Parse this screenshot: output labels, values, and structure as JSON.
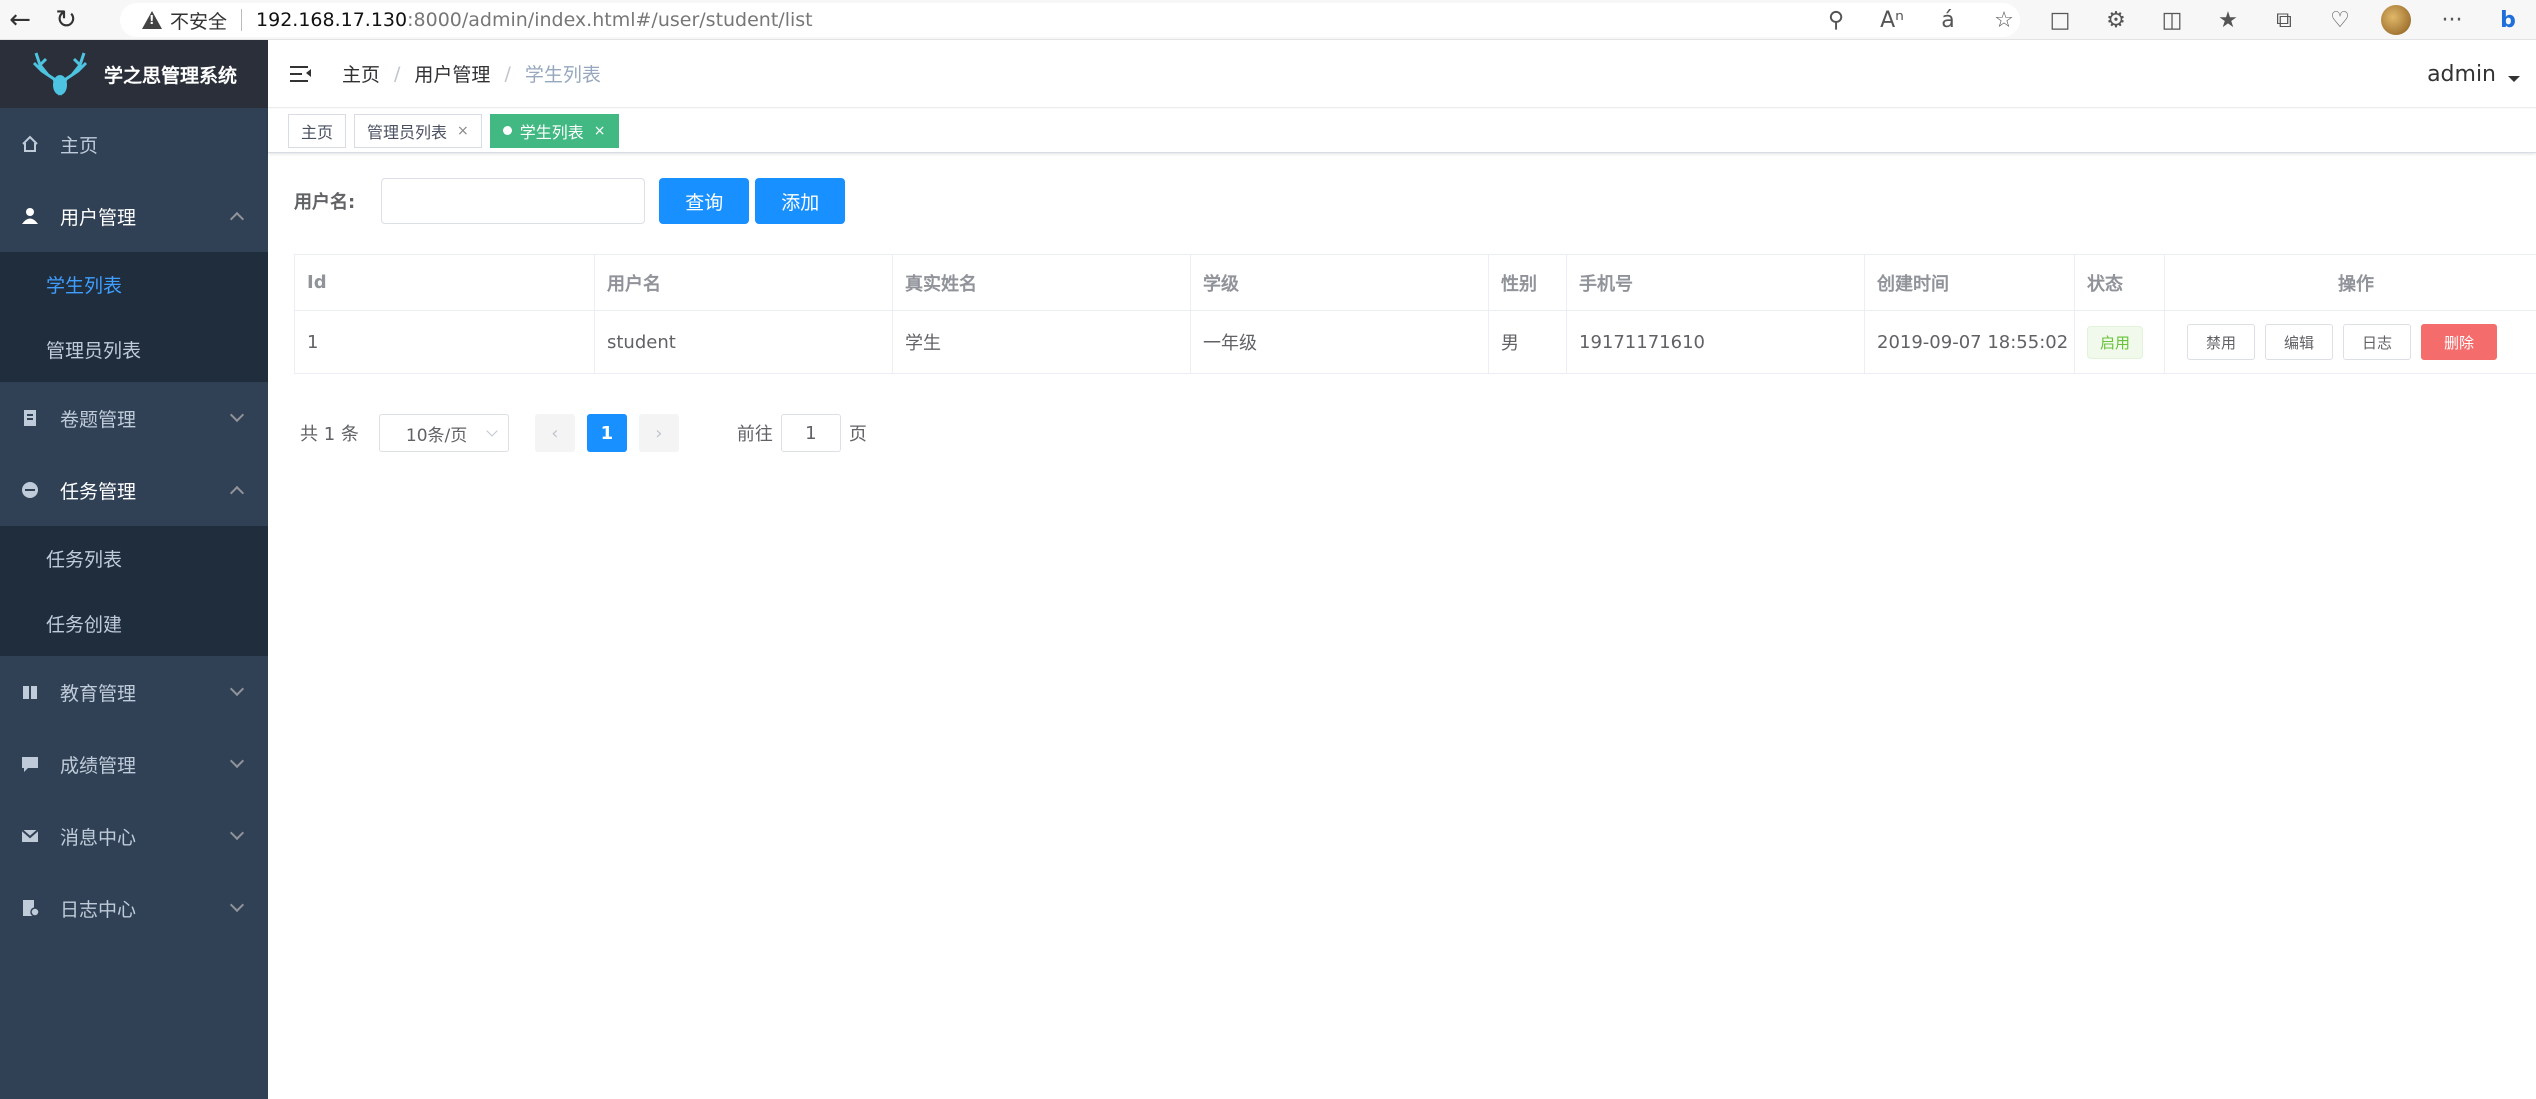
{
  "browser": {
    "insecure_label": "不安全",
    "url_host": "192.168.17.130",
    "url_rest": ":8000/admin/index.html#/user/student/list"
  },
  "app": {
    "title": "学之思管理系统"
  },
  "sidebar": {
    "items": [
      {
        "label": "主页",
        "icon": "home-icon"
      },
      {
        "label": "用户管理",
        "icon": "user-icon",
        "open": true,
        "children": [
          {
            "label": "学生列表",
            "active": true
          },
          {
            "label": "管理员列表"
          }
        ]
      },
      {
        "label": "卷题管理",
        "icon": "document-icon"
      },
      {
        "label": "任务管理",
        "icon": "task-icon",
        "open": true,
        "children": [
          {
            "label": "任务列表"
          },
          {
            "label": "任务创建"
          }
        ]
      },
      {
        "label": "教育管理",
        "icon": "book-icon"
      },
      {
        "label": "成绩管理",
        "icon": "chat-icon"
      },
      {
        "label": "消息中心",
        "icon": "mail-icon"
      },
      {
        "label": "日志中心",
        "icon": "log-icon"
      }
    ]
  },
  "header": {
    "breadcrumb": [
      "主页",
      "用户管理",
      "学生列表"
    ],
    "separator": "/",
    "user": "admin"
  },
  "tags": [
    {
      "label": "主页",
      "closable": false
    },
    {
      "label": "管理员列表",
      "closable": true
    },
    {
      "label": "学生列表",
      "closable": true,
      "active": true
    }
  ],
  "filter": {
    "label": "用户名:",
    "input_value": "",
    "query_label": "查询",
    "add_label": "添加"
  },
  "table": {
    "columns": [
      "Id",
      "用户名",
      "真实姓名",
      "学级",
      "性别",
      "手机号",
      "创建时间",
      "状态",
      "操作"
    ],
    "rows": [
      {
        "id": "1",
        "username": "student",
        "real_name": "学生",
        "level": "一年级",
        "sex": "男",
        "phone": "19171171610",
        "created": "2019-09-07 18:55:02",
        "status": "启用"
      }
    ],
    "actions": [
      "禁用",
      "编辑",
      "日志",
      "删除"
    ]
  },
  "pagination": {
    "total_label": "共 1 条",
    "page_size": "10条/页",
    "current_page": "1",
    "goto_label": "前往",
    "goto_value": "1",
    "page_unit": "页"
  },
  "colors": {
    "sidebar_bg": "#304156",
    "submenu_bg": "#1f2d3d",
    "primary": "#1890ff",
    "active_tag": "#42b983",
    "danger": "#f56c6c"
  }
}
